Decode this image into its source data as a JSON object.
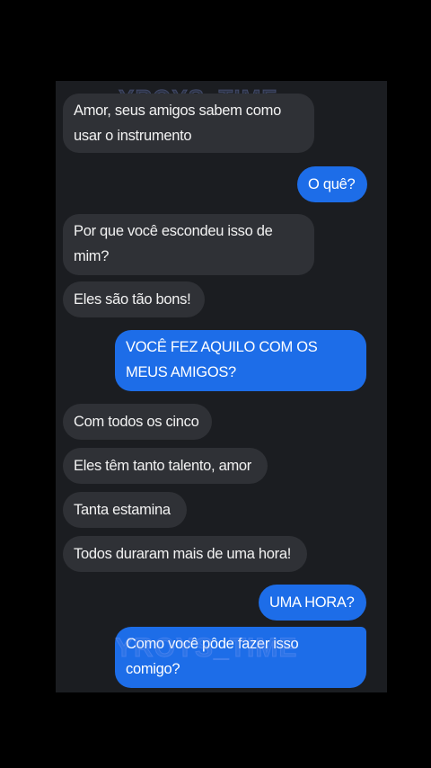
{
  "watermark": "YROYS_TIME",
  "colors": {
    "background": "#000000",
    "panel": "#1b1d21",
    "received_bubble": "#2f3136",
    "sent_bubble": "#1d6de8"
  },
  "messages": [
    {
      "sender": "received",
      "text": "Amor, seus amigos sabem como usar o instrumento"
    },
    {
      "sender": "sent",
      "text": "O quê?"
    },
    {
      "sender": "received",
      "text": "Por que você escondeu isso de mim?"
    },
    {
      "sender": "received",
      "text": "Eles são tão bons!"
    },
    {
      "sender": "sent",
      "text": "VOCÊ FEZ AQUILO COM OS MEUS AMIGOS?"
    },
    {
      "sender": "received",
      "text": "Com todos os cinco"
    },
    {
      "sender": "received",
      "text": "Eles têm tanto talento, amor"
    },
    {
      "sender": "received",
      "text": "Tanta estamina"
    },
    {
      "sender": "received",
      "text": "Todos duraram mais de uma hora!"
    },
    {
      "sender": "sent",
      "text": "UMA HORA?"
    },
    {
      "sender": "sent",
      "text": "Como você pôde fazer isso comigo?"
    }
  ]
}
